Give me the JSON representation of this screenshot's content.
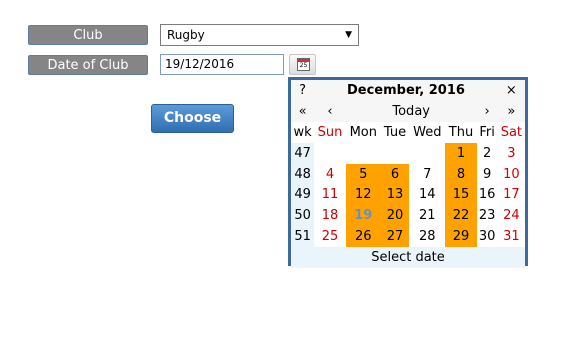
{
  "form": {
    "club_label": "Club",
    "club_value": "Rugby",
    "date_label": "Date of Club",
    "date_value": "19/12/2016",
    "choose_label": "Choose",
    "cal_icon_day": "25"
  },
  "calendar": {
    "help": "?",
    "title": "December, 2016",
    "close": "×",
    "prev_year": "«",
    "prev_month": "‹",
    "today": "Today",
    "next_month": "›",
    "next_year": "»",
    "weekday_header": [
      "wk",
      "Sun",
      "Mon",
      "Tue",
      "Wed",
      "Thu",
      "Fri",
      "Sat"
    ],
    "weeks": [
      {
        "wk": "47",
        "days": [
          "",
          "",
          "",
          "",
          "1",
          "2",
          "3"
        ]
      },
      {
        "wk": "48",
        "days": [
          "4",
          "5",
          "6",
          "7",
          "8",
          "9",
          "10"
        ]
      },
      {
        "wk": "49",
        "days": [
          "11",
          "12",
          "13",
          "14",
          "15",
          "16",
          "17"
        ]
      },
      {
        "wk": "50",
        "days": [
          "18",
          "19",
          "20",
          "21",
          "22",
          "23",
          "24"
        ]
      },
      {
        "wk": "51",
        "days": [
          "25",
          "26",
          "27",
          "28",
          "29",
          "30",
          "31"
        ]
      }
    ],
    "footer": "Select date",
    "highlight_color": "#ffa200",
    "weekend_color": "#d00000"
  }
}
